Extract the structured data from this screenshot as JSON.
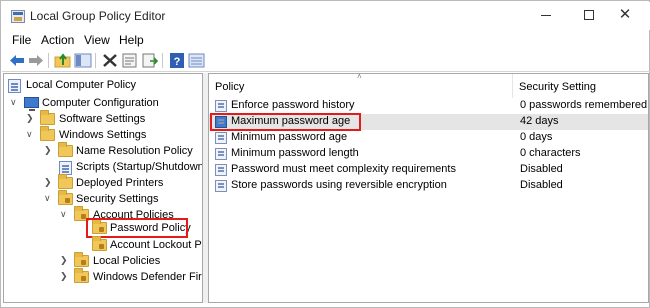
{
  "window": {
    "title": "Local Group Policy Editor"
  },
  "menu": {
    "file": "File",
    "action": "Action",
    "view": "View",
    "help": "Help"
  },
  "tree": {
    "root": "Local Computer Policy",
    "computer_config": "Computer Configuration",
    "software_settings": "Software Settings",
    "windows_settings": "Windows Settings",
    "name_resolution": "Name Resolution Policy",
    "scripts": "Scripts (Startup/Shutdown)",
    "deployed_printers": "Deployed Printers",
    "security_settings": "Security Settings",
    "account_policies": "Account Policies",
    "password_policy": "Password Policy",
    "account_lockout": "Account Lockout Policy",
    "local_policies": "Local Policies",
    "windows_defender": "Windows Defender Firewall"
  },
  "list": {
    "col_policy": "Policy",
    "col_setting": "Security Setting",
    "rows": [
      {
        "policy": "Enforce password history",
        "setting": "0 passwords remembered"
      },
      {
        "policy": "Maximum password age",
        "setting": "42 days"
      },
      {
        "policy": "Minimum password age",
        "setting": "0 days"
      },
      {
        "policy": "Minimum password length",
        "setting": "0 characters"
      },
      {
        "policy": "Password must meet complexity requirements",
        "setting": "Disabled"
      },
      {
        "policy": "Store passwords using reversible encryption",
        "setting": "Disabled"
      }
    ]
  },
  "colors": {
    "highlight": "#e21b1b",
    "selected_row": "#e5e5e5"
  }
}
